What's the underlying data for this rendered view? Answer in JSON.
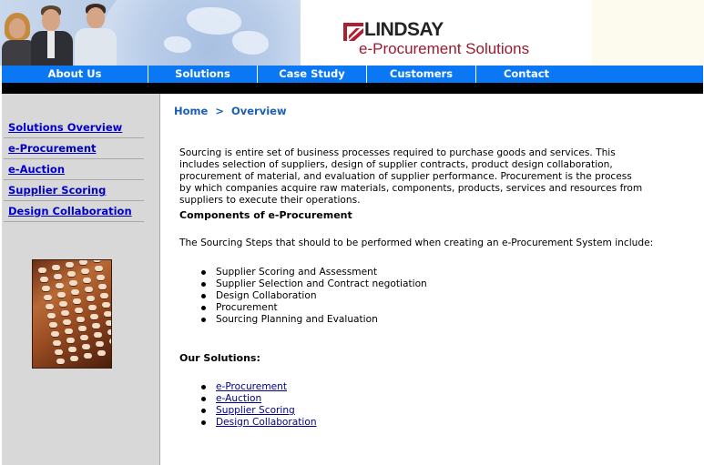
{
  "header": {
    "logo_name": "LINDSAY",
    "logo_tagline": "e-Procurement Solutions",
    "brand_colors": {
      "logo_mark": "#b01e2e",
      "tagline": "#9b1b2f",
      "nav": "#0a78f5"
    }
  },
  "nav": {
    "items": [
      {
        "label": "About Us"
      },
      {
        "label": "Solutions"
      },
      {
        "label": "Case Study"
      },
      {
        "label": "Customers"
      },
      {
        "label": "Contact"
      }
    ]
  },
  "sidebar": {
    "links": [
      {
        "label": "Solutions Overview"
      },
      {
        "label": "e-Procurement"
      },
      {
        "label": "e-Auction"
      },
      {
        "label": "Supplier Scoring"
      },
      {
        "label": "Design Collaboration"
      }
    ],
    "image_icon": "calculator-photo"
  },
  "main": {
    "breadcrumb": {
      "home": "Home",
      "separator": ">",
      "current": "Overview"
    },
    "intro": "Sourcing is entire set of business processes required to purchase goods and services. This includes selection of suppliers, design of supplier contracts, product design collaboration, procurement of material, and evaluation of supplier performance. Procurement is the process by which companies acquire raw materials, components, products, services and resources from suppliers to execute their operations.",
    "components_heading": "Components of e-Procurement",
    "steps_intro": "The Sourcing Steps that should to be performed when creating an e-Procurement System include:",
    "steps": [
      "Supplier Scoring and Assessment",
      "Supplier Selection and Contract negotiation",
      "Design Collaboration",
      "Procurement",
      "Sourcing Planning and Evaluation"
    ],
    "solutions_heading": "Our Solutions:",
    "solutions": [
      "e-Procurement",
      "e-Auction",
      "Supplier Scoring",
      "Design Collaboration"
    ]
  }
}
